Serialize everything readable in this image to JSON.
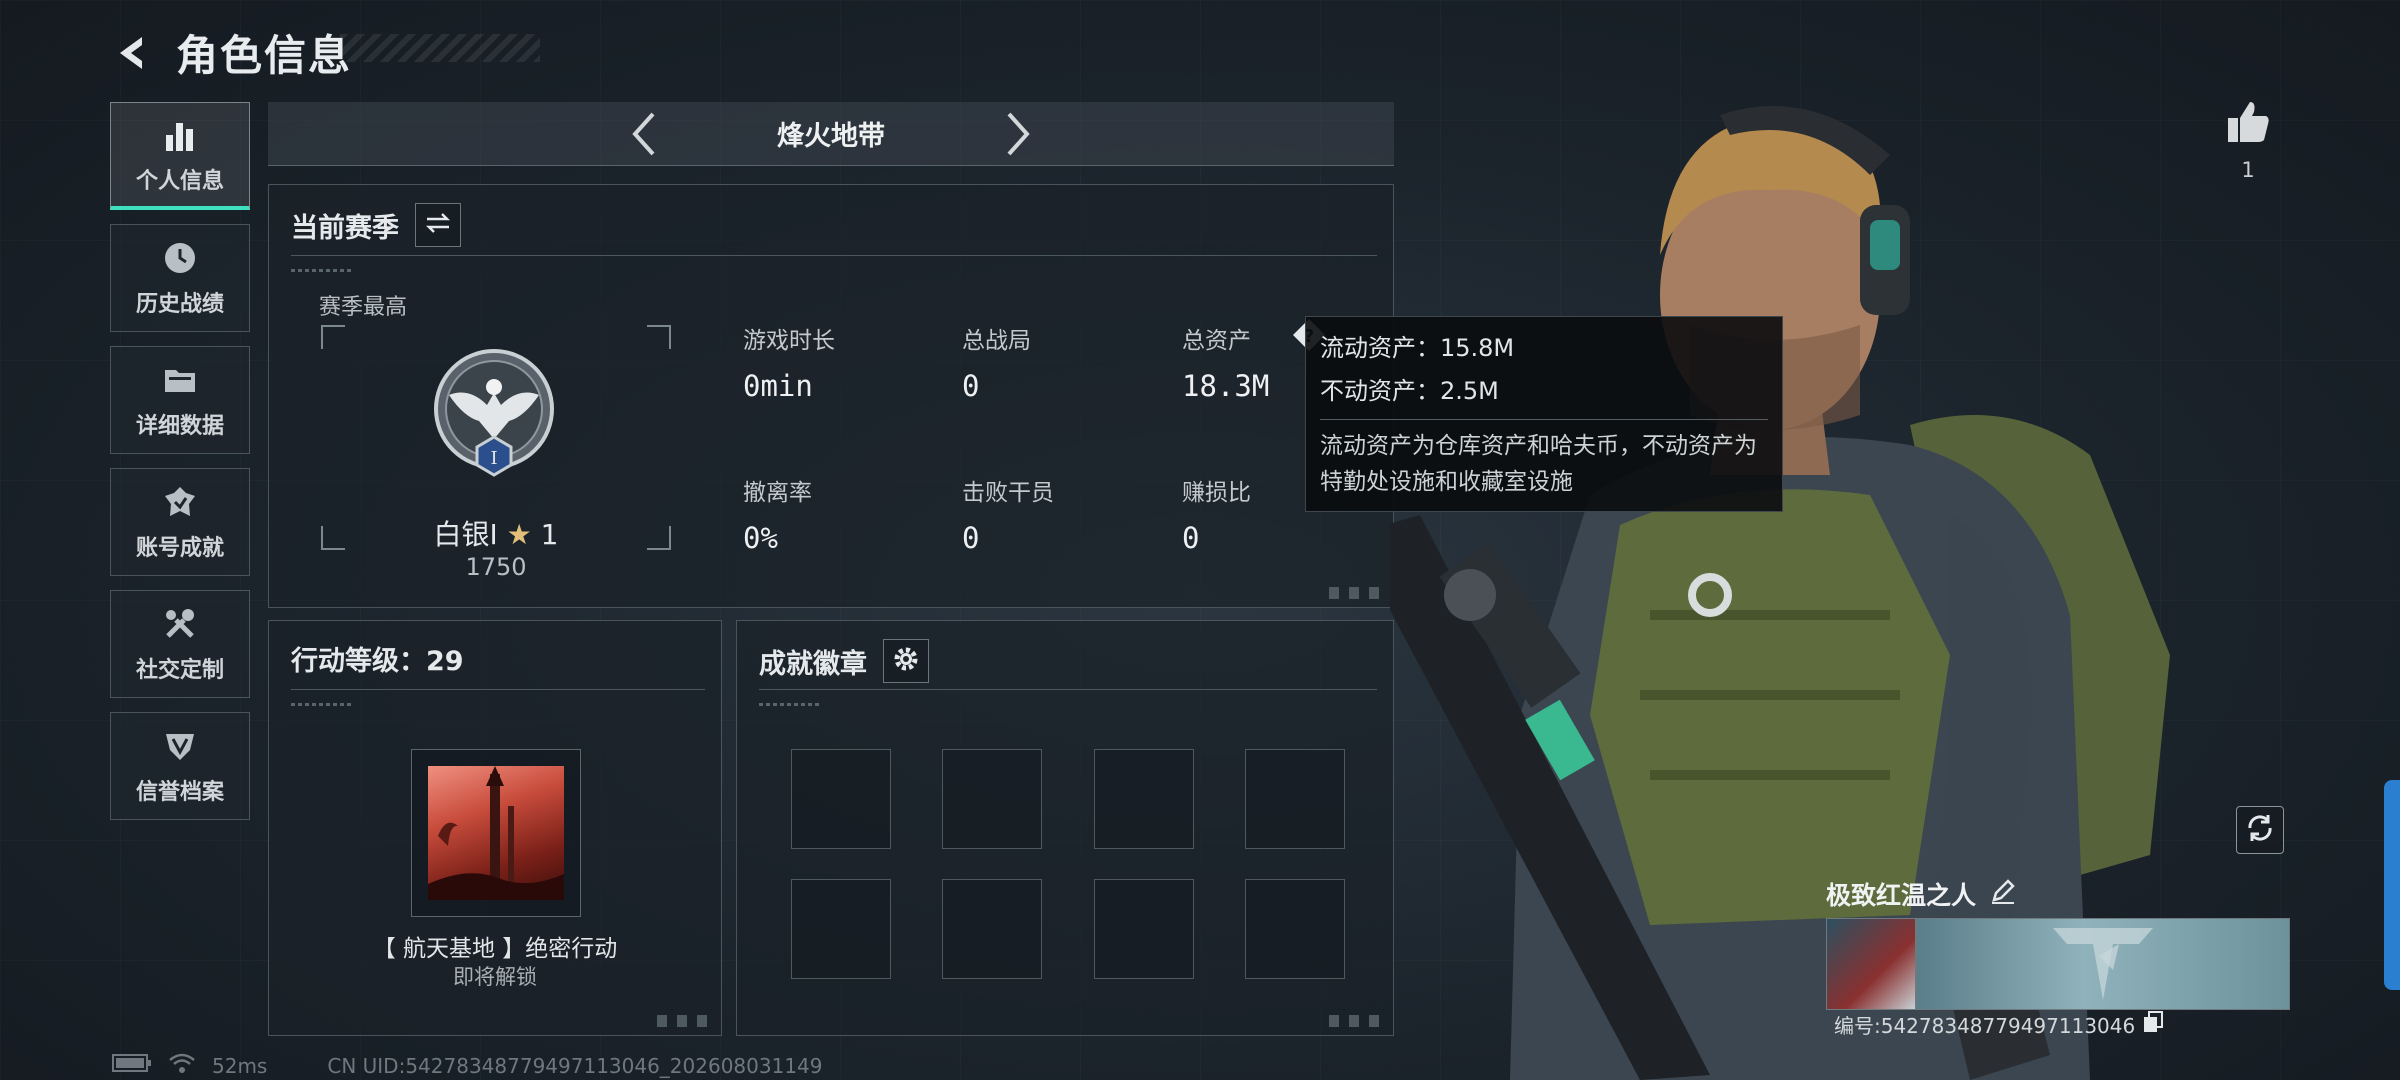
{
  "header": {
    "title": "角色信息"
  },
  "sidebar": {
    "items": [
      {
        "label": "个人信息",
        "icon": "bar-chart-icon",
        "active": true
      },
      {
        "label": "历史战绩",
        "icon": "history-clock-icon"
      },
      {
        "label": "详细数据",
        "icon": "folder-icon"
      },
      {
        "label": "账号成就",
        "icon": "achievement-icon"
      },
      {
        "label": "社交定制",
        "icon": "tools-icon"
      },
      {
        "label": "信誉档案",
        "icon": "credit-shield-icon"
      }
    ]
  },
  "mode": {
    "title": "烽火地带"
  },
  "season": {
    "title": "当前赛季",
    "best_label": "赛季最高",
    "rank_name": "白银I",
    "rank_stars": "1",
    "rank_points": "1750",
    "stats": [
      {
        "label": "游戏时长",
        "value": "0min"
      },
      {
        "label": "总战局",
        "value": "0"
      },
      {
        "label": "总资产",
        "value": "18.3M"
      },
      {
        "label": "撤离率",
        "value": "0%"
      },
      {
        "label": "击败干员",
        "value": "0"
      },
      {
        "label": "赚损比",
        "value": "0"
      }
    ]
  },
  "tooltip": {
    "liquid": "流动资产：15.8M",
    "fixed": "不动资产：2.5M",
    "desc": "流动资产为仓库资产和哈夫币，不动资产为特勤处设施和收藏室设施"
  },
  "operation": {
    "title": "行动等级：29",
    "name": "【 航天基地 】绝密行动",
    "status": "即将解锁"
  },
  "badges": {
    "title": "成就徽章"
  },
  "likes": {
    "count": "1"
  },
  "player": {
    "name": "极致红温之人",
    "id": "编号:542783487794971130​46"
  },
  "footer": {
    "ping": "52ms",
    "uid": "CN UID:542783487794971130​46_202608031149"
  },
  "colors": {
    "accent": "#3fe0c0",
    "panel": "#1a2128",
    "side_tab": "#2a7fd0"
  }
}
